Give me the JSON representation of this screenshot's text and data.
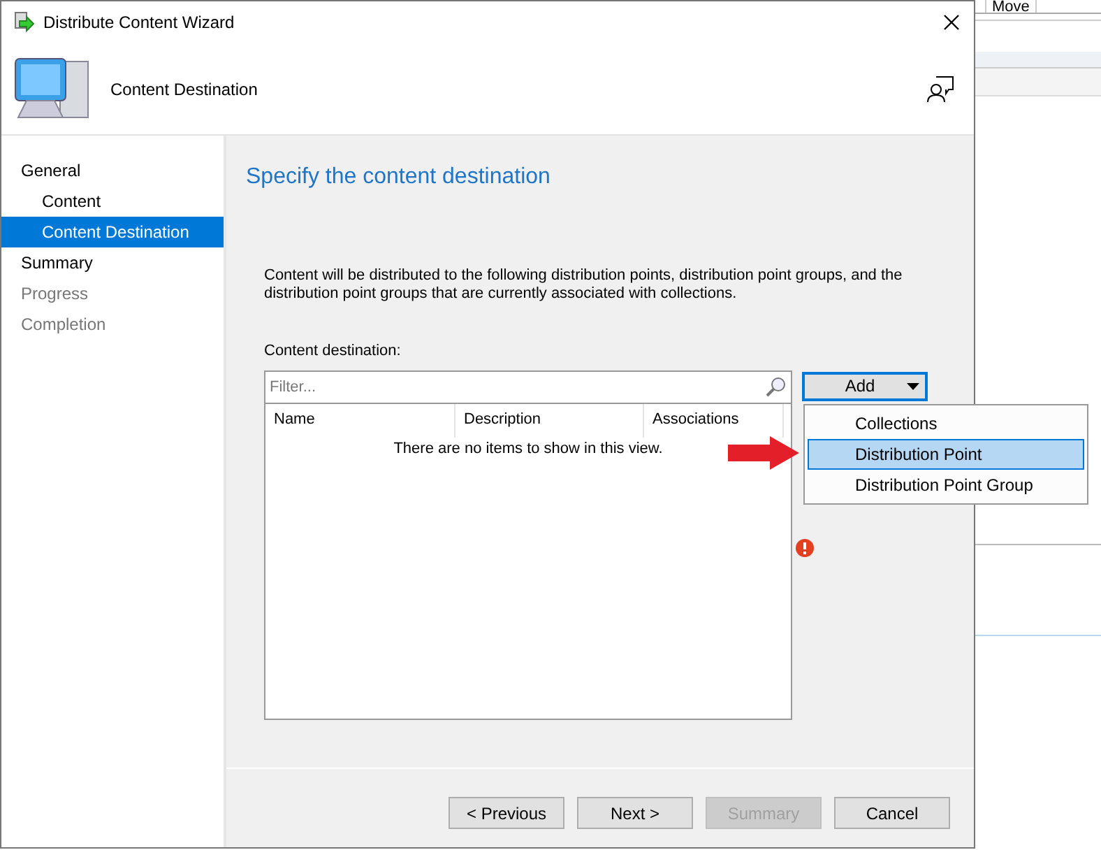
{
  "background_app": {
    "tab": "Move"
  },
  "window": {
    "title": "Distribute Content Wizard"
  },
  "header": {
    "title": "Content Destination"
  },
  "nav": [
    {
      "label": "General",
      "selected": false,
      "disabled": false,
      "children": [
        {
          "label": "Content",
          "selected": false,
          "disabled": false
        },
        {
          "label": "Content Destination",
          "selected": true,
          "disabled": false
        }
      ]
    },
    {
      "label": "Summary",
      "selected": false,
      "disabled": false
    },
    {
      "label": "Progress",
      "selected": false,
      "disabled": true
    },
    {
      "label": "Completion",
      "selected": false,
      "disabled": true
    }
  ],
  "page": {
    "heading": "Specify the content destination",
    "description": "Content will be distributed to the following distribution points, distribution point groups, and the distribution point groups that are currently associated with collections.",
    "list_label": "Content destination:",
    "filter": {
      "placeholder": "Filter..."
    },
    "add_button": "Add",
    "table": {
      "columns": [
        "Name",
        "Description",
        "Associations"
      ],
      "empty_text": "There are no items to show in this view."
    },
    "add_menu": [
      {
        "label": "Collections",
        "selected": false
      },
      {
        "label": "Distribution Point",
        "selected": true
      },
      {
        "label": "Distribution Point Group",
        "selected": false
      }
    ]
  },
  "buttons": [
    {
      "label": "< Previous",
      "disabled": false
    },
    {
      "label": "Next >",
      "disabled": false
    },
    {
      "label": "Summary",
      "disabled": true
    },
    {
      "label": "Cancel",
      "disabled": false
    }
  ]
}
